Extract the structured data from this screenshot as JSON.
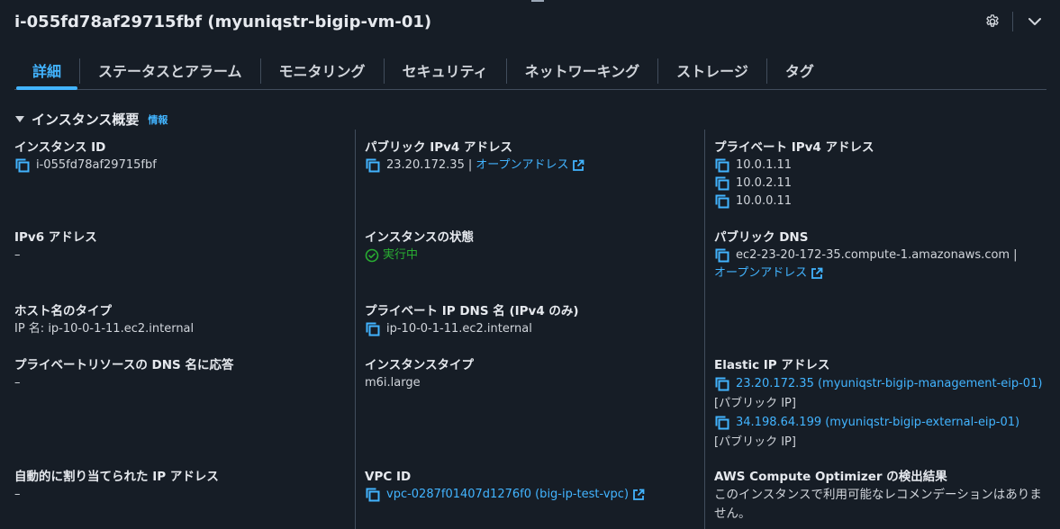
{
  "header": {
    "title": "i-055fd78af29715fbf (myuniqstr-bigip-vm-01)"
  },
  "tabs": [
    {
      "label": "詳細",
      "active": true
    },
    {
      "label": "ステータスとアラーム"
    },
    {
      "label": "モニタリング"
    },
    {
      "label": "セキュリティ"
    },
    {
      "label": "ネットワーキング"
    },
    {
      "label": "ストレージ"
    },
    {
      "label": "タグ"
    }
  ],
  "section": {
    "title": "インスタンス概要",
    "info": "情報"
  },
  "fields": {
    "instance_id": {
      "label": "インスタンス ID",
      "value": "i-055fd78af29715fbf"
    },
    "public_ipv4": {
      "label": "パブリック IPv4 アドレス",
      "value": "23.20.172.35",
      "separator": "|",
      "link": "オープンアドレス"
    },
    "private_ipv4": {
      "label": "プライベート IPv4 アドレス",
      "values": [
        "10.0.1.11",
        "10.0.2.11",
        "10.0.0.11"
      ]
    },
    "ipv6": {
      "label": "IPv6 アドレス",
      "value": "–"
    },
    "instance_state": {
      "label": "インスタンスの状態",
      "value": "実行中"
    },
    "public_dns": {
      "label": "パブリック DNS",
      "value": "ec2-23-20-172-35.compute-1.amazonaws.com",
      "separator": "|",
      "link": "オープンアドレス"
    },
    "hostname_type": {
      "label": "ホスト名のタイプ",
      "value": "IP 名: ip-10-0-1-11.ec2.internal"
    },
    "private_ip_dns": {
      "label": "プライベート IP DNS 名 (IPv4 のみ)",
      "value": "ip-10-0-1-11.ec2.internal"
    },
    "private_resource_dns": {
      "label": "プライベートリソースの DNS 名に応答",
      "value": "–"
    },
    "instance_type": {
      "label": "インスタンスタイプ",
      "value": "m6i.large"
    },
    "elastic_ip": {
      "label": "Elastic IP アドレス",
      "items": [
        {
          "value": "23.20.172.35 (myuniqstr-bigip-management-eip-01)",
          "kind": "[パブリック IP]"
        },
        {
          "value": "34.198.64.199 (myuniqstr-bigip-external-eip-01)",
          "kind": "[パブリック IP]"
        }
      ]
    },
    "auto_assigned_ip": {
      "label": "自動的に割り当てられた IP アドレス",
      "value": "–"
    },
    "vpc_id": {
      "label": "VPC ID",
      "value": "vpc-0287f01407d1276f0 (big-ip-test-vpc)"
    },
    "compute_optimizer": {
      "label": "AWS Compute Optimizer の検出結果",
      "value": "このインスタンスで利用可能なレコメンデーションはありません。"
    }
  },
  "colors": {
    "background": "#161d26",
    "accent": "#42b4ff",
    "success": "#29ad32",
    "divider": "#414d5c"
  },
  "icons": [
    "gear-icon",
    "chevron-down-icon",
    "copy-icon",
    "external-link-icon",
    "check-circle-icon",
    "caret-down-icon"
  ]
}
